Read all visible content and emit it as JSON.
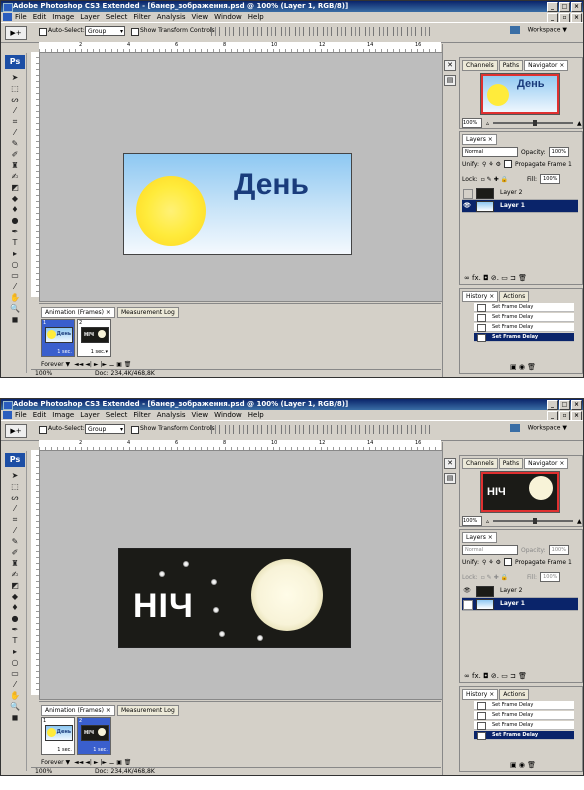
{
  "shots": [
    {
      "title": "Adobe Photoshop CS3 Extended - [банер_зображення.psd @ 100% (Layer 1, RGB/8)]",
      "menu": [
        "File",
        "Edit",
        "Image",
        "Layer",
        "Select",
        "Filter",
        "Analysis",
        "View",
        "Window",
        "Help"
      ],
      "options": {
        "auto_select": "Auto-Select:",
        "group": "Group",
        "show_transform": "Show Transform Controls",
        "workspace": "Workspace ▼"
      },
      "ruler": [
        "2",
        "4",
        "6",
        "8",
        "10",
        "12",
        "14",
        "16"
      ],
      "canvas_text": "День",
      "anim_tabs": [
        "Animation (Frames) ×",
        "Measurement Log"
      ],
      "frames": [
        {
          "num": "1",
          "delay": "1 sec.",
          "thumb_text": "День"
        },
        {
          "num": "2",
          "delay": "1 sec.▾",
          "thumb_text": "НІЧ"
        }
      ],
      "anim_controls": {
        "loop": "Forever ▼",
        "buttons": "◄◄  ◄|  ►  |►  ⚊  ▣  🗑"
      },
      "status": {
        "zoom": "100%",
        "doc": "Doc: 234,4K/468,8K"
      },
      "nav_tabs": [
        "Channels",
        "Paths",
        "Navigator ×"
      ],
      "nav_zoom": "100%",
      "nav_text": "День",
      "layers_tab": "Layers ×",
      "blend": "Normal",
      "opacity_label": "Opacity:",
      "opacity": "100%",
      "unify": "Unify:",
      "propagate": "Propagate Frame 1",
      "lock": "Lock:",
      "fill_label": "Fill:",
      "fill": "100%",
      "layers": [
        "Layer 2",
        "Layer 1"
      ],
      "layer_icons": "∞  fx.  ◘  ⊘.  ▭  ⊐  🗑",
      "hist_tabs": [
        "History ×",
        "Actions"
      ],
      "history": [
        "Set Frame Delay",
        "Set Frame Delay",
        "Set Frame Delay",
        "Set Frame Delay"
      ]
    },
    {
      "title": "Adobe Photoshop CS3 Extended - [банер_зображення.psd @ 100% (Layer 1, RGB/8)]",
      "menu": [
        "File",
        "Edit",
        "Image",
        "Layer",
        "Select",
        "Filter",
        "Analysis",
        "View",
        "Window",
        "Help"
      ],
      "options": {
        "auto_select": "Auto-Select:",
        "group": "Group",
        "show_transform": "Show Transform Controls",
        "workspace": "Workspace ▼"
      },
      "ruler": [
        "2",
        "4",
        "6",
        "8",
        "10",
        "12",
        "14",
        "16"
      ],
      "canvas_text": "НІЧ",
      "anim_tabs": [
        "Animation (Frames) ×",
        "Measurement Log"
      ],
      "frames": [
        {
          "num": "1",
          "delay": "1 sec.",
          "thumb_text": "День"
        },
        {
          "num": "2",
          "delay": "1 sec.",
          "thumb_text": "НІЧ"
        }
      ],
      "anim_controls": {
        "loop": "Forever ▼",
        "buttons": "◄◄  ◄|  ►  |►  ⚊  ▣  🗑"
      },
      "status": {
        "zoom": "100%",
        "doc": "Doc: 234,4K/468,8K"
      },
      "nav_tabs": [
        "Channels",
        "Paths",
        "Navigator ×"
      ],
      "nav_zoom": "100%",
      "nav_text": "НІЧ",
      "layers_tab": "Layers ×",
      "blend": "Normal",
      "opacity_label": "Opacity:",
      "opacity": "100%",
      "unify": "Unify:",
      "propagate": "Propagate Frame 1",
      "lock": "Lock:",
      "fill_label": "Fill:",
      "fill": "100%",
      "layers": [
        "Layer 2",
        "Layer 1"
      ],
      "layer_icons": "∞  fx.  ◘  ⊘.  ▭  ⊐  🗑",
      "hist_tabs": [
        "History ×",
        "Actions"
      ],
      "history": [
        "Set Frame Delay",
        "Set Frame Delay",
        "Set Frame Delay",
        "Set Frame Delay"
      ]
    }
  ]
}
